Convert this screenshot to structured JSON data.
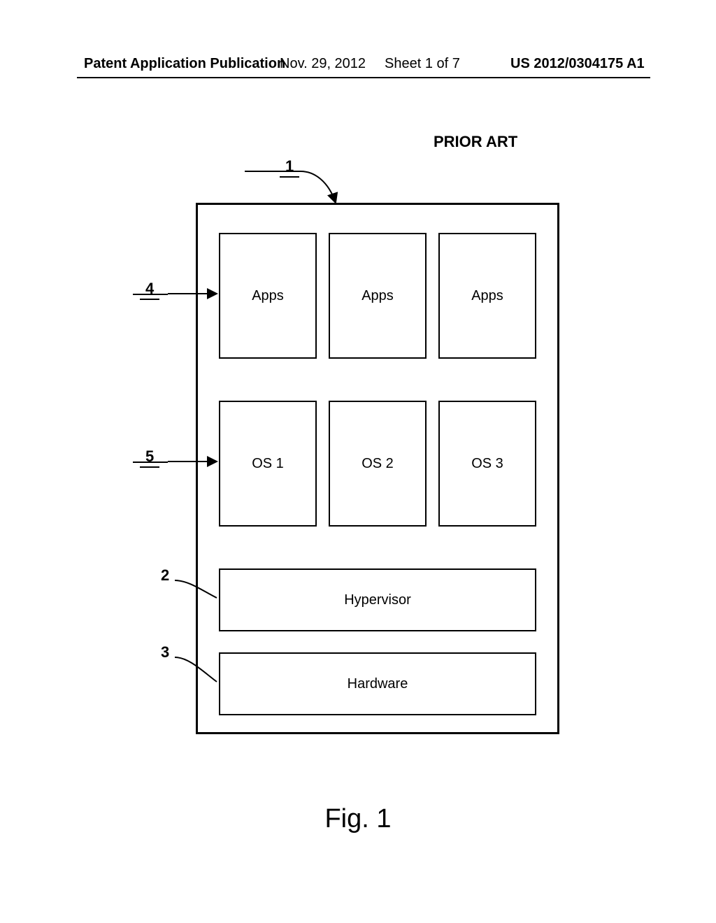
{
  "header": {
    "pub_type": "Patent Application Publication",
    "pub_date": "Nov. 29, 2012",
    "sheet": "Sheet 1 of 7",
    "pub_num": "US 2012/0304175 A1"
  },
  "labels": {
    "prior_art": "PRIOR ART",
    "figure": "Fig. 1"
  },
  "refs": {
    "r1": "1",
    "r2": "2",
    "r3": "3",
    "r4": "4",
    "r5": "5"
  },
  "boxes": {
    "apps": [
      "Apps",
      "Apps",
      "Apps"
    ],
    "os": [
      "OS 1",
      "OS 2",
      "OS 3"
    ],
    "hypervisor": "Hypervisor",
    "hardware": "Hardware"
  }
}
